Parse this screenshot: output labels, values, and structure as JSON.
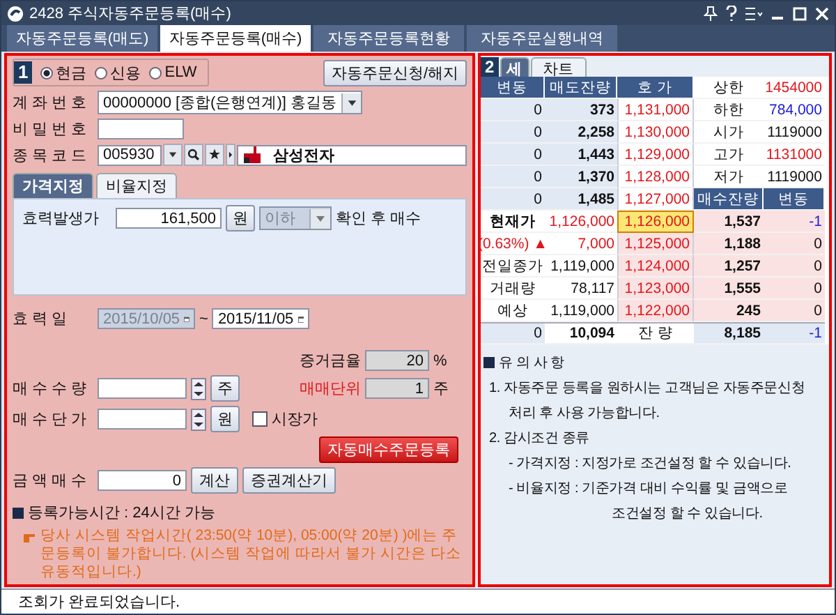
{
  "window": {
    "title": "2428 주식자동주문등록(매수)"
  },
  "tabs": [
    {
      "label": "자동주문등록(매도)",
      "selected": false
    },
    {
      "label": "자동주문등록(매수)",
      "selected": true
    },
    {
      "label": "자동주문등록현황",
      "selected": false
    },
    {
      "label": "자동주문실행내역",
      "selected": false
    }
  ],
  "order_panel": {
    "badge": "1",
    "account_types": [
      {
        "label": "현금",
        "selected": true
      },
      {
        "label": "신용",
        "selected": false
      },
      {
        "label": "ELW",
        "selected": false
      }
    ],
    "apply_button": "자동주문신청/해지",
    "account": {
      "label": "계 좌 번 호",
      "value": "00000000 [종합(은행연계)] 홍길동"
    },
    "password": {
      "label": "비 밀 번 호"
    },
    "stock": {
      "label": "종 목 코 드",
      "code": "005930",
      "name": "삼성전자"
    },
    "condition_tabs": [
      {
        "label": "가격지정",
        "selected": true
      },
      {
        "label": "비율지정",
        "selected": false
      }
    ],
    "trigger": {
      "label": "효력발생가",
      "value": "161,500",
      "unit": "원",
      "condition": "이하",
      "suffix": "확인 후 매수"
    },
    "period": {
      "label": "효 력 일",
      "from": "2015/10/05",
      "from_disabled": true,
      "separator": "~",
      "to": "2015/11/05"
    },
    "margin": {
      "label": "증거금율",
      "value": "20",
      "unit": "%"
    },
    "lot": {
      "label": "매매단위",
      "value": "1",
      "unit": "주"
    },
    "quantity": {
      "label": "매 수 수 량",
      "unit": "주"
    },
    "price": {
      "label": "매 수 단 가",
      "unit": "원",
      "market_price": {
        "label": "시장가",
        "checked": false
      }
    },
    "submit_button": "자동매수주문등록",
    "amount": {
      "label": "금 액 매 수",
      "value": "0",
      "calc_button": "계산",
      "calculator_button": "증권계산기"
    },
    "notice": {
      "title": "등록가능시간 : 24시간 가능",
      "text": "당사 시스템 작업시간( 23:50(약 10분), 05:00(약 20분) )에는 주문등록이 불가합니다. (시스템 작업에 따라서 불가 시간은 다소 유동적입니다.)"
    }
  },
  "quote_panel": {
    "badge": "2",
    "tabs": [
      {
        "label": "세",
        "selected": true
      },
      {
        "label": "차트",
        "selected": false
      }
    ],
    "ask_columns": [
      "변동",
      "매도잔량",
      "호 가"
    ],
    "asks": [
      {
        "change": "0",
        "quantity": "373",
        "price": "1,131,000"
      },
      {
        "change": "0",
        "quantity": "2,258",
        "price": "1,130,000"
      },
      {
        "change": "0",
        "quantity": "1,443",
        "price": "1,129,000"
      },
      {
        "change": "0",
        "quantity": "1,370",
        "price": "1,128,000"
      },
      {
        "change": "0",
        "quantity": "1,485",
        "price": "1,127,000"
      }
    ],
    "info": [
      {
        "label": "상한",
        "value": "1454000",
        "color": "#e0161b"
      },
      {
        "label": "하한",
        "value": "784,000",
        "color": "#1a1adc"
      },
      {
        "label": "시가",
        "value": "1119000",
        "color": "#111111"
      },
      {
        "label": "고가",
        "value": "1131000",
        "color": "#e0161b"
      },
      {
        "label": "저가",
        "value": "1119000",
        "color": "#111111"
      }
    ],
    "bid_columns": [
      "매수잔량",
      "변동"
    ],
    "bids": [
      {
        "label": "현재가",
        "value": "1,126,000",
        "price": "1,126,000",
        "quantity": "1,537",
        "change": "-1",
        "selected": true,
        "color": "#1a1adc"
      },
      {
        "label": "(0.63%) ▲",
        "value": "7,000",
        "price": "1,125,000",
        "quantity": "1,188",
        "change": "0",
        "selected": false,
        "color": "#111111"
      },
      {
        "label": "전일종가",
        "value": "1,119,000",
        "price": "1,124,000",
        "quantity": "1,257",
        "change": "0",
        "selected": false,
        "color": "#111111"
      },
      {
        "label": "거래량",
        "value": "78,117",
        "price": "1,123,000",
        "quantity": "1,555",
        "change": "0",
        "selected": false,
        "color": "#111111"
      },
      {
        "label": "예상",
        "value": "1,119,000",
        "price": "1,122,000",
        "quantity": "245",
        "change": "0",
        "selected": false,
        "color": "#111111"
      }
    ],
    "totals": {
      "ask_change": "0",
      "ask_quantity": "10,094",
      "label": "잔 량",
      "bid_quantity": "8,185",
      "bid_change": "-1"
    },
    "notes": {
      "title": "유 의 사 항",
      "lines": [
        "1. 자동주문 등록을 원하시는 고객님은 자동주문신청",
        "처리 후 사용 가능합니다.",
        "2. 감시조건 종류",
        "- 가격지정 : 지정가로 조건설정 할 수 있습니다.",
        "- 비율지정 : 기준가격 대비 수익률 및 금액으로",
        "조건설정 할 수 있습니다."
      ]
    }
  },
  "status_bar": {
    "text": "조회가 완료되었습니다."
  }
}
